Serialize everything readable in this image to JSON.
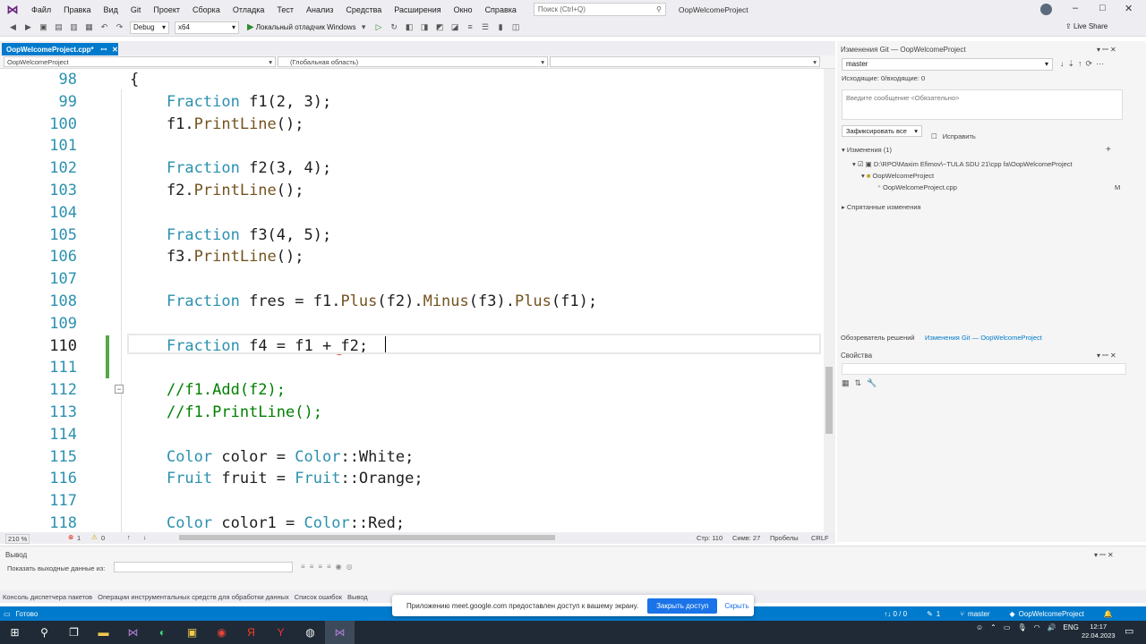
{
  "menu": {
    "items": [
      "Файл",
      "Правка",
      "Вид",
      "Git",
      "Проект",
      "Сборка",
      "Отладка",
      "Тест",
      "Анализ",
      "Средства",
      "Расширения",
      "Окно",
      "Справка"
    ],
    "search_placeholder": "Поиск (Ctrl+Q)",
    "window_title": "OopWelcomeProject",
    "live_share": "Live Share"
  },
  "toolbar": {
    "config": "Debug",
    "platform": "x64",
    "run_label": "Локальный отладчик Windows"
  },
  "document": {
    "tab_label": "OopWelcomeProject.cpp*",
    "nav_project": "OopWelcomeProject",
    "nav_scope": "(Глобальная область)"
  },
  "code_lines": [
    {
      "n": "98",
      "code": [
        {
          "t": "{",
          "k": "p"
        }
      ]
    },
    {
      "n": "99",
      "code": [
        {
          "t": "    ",
          "k": "p"
        },
        {
          "t": "Fraction",
          "k": "t"
        },
        {
          "t": " f1(2, 3);",
          "k": "p"
        }
      ]
    },
    {
      "n": "100",
      "code": [
        {
          "t": "    f1.",
          "k": "p"
        },
        {
          "t": "PrintLine",
          "k": "f"
        },
        {
          "t": "();",
          "k": "p"
        }
      ]
    },
    {
      "n": "101",
      "code": []
    },
    {
      "n": "102",
      "code": [
        {
          "t": "    ",
          "k": "p"
        },
        {
          "t": "Fraction",
          "k": "t"
        },
        {
          "t": " f2(3, 4);",
          "k": "p"
        }
      ]
    },
    {
      "n": "103",
      "code": [
        {
          "t": "    f2.",
          "k": "p"
        },
        {
          "t": "PrintLine",
          "k": "f"
        },
        {
          "t": "();",
          "k": "p"
        }
      ]
    },
    {
      "n": "104",
      "code": []
    },
    {
      "n": "105",
      "code": [
        {
          "t": "    ",
          "k": "p"
        },
        {
          "t": "Fraction",
          "k": "t"
        },
        {
          "t": " f3(4, 5);",
          "k": "p"
        }
      ]
    },
    {
      "n": "106",
      "code": [
        {
          "t": "    f3.",
          "k": "p"
        },
        {
          "t": "PrintLine",
          "k": "f"
        },
        {
          "t": "();",
          "k": "p"
        }
      ]
    },
    {
      "n": "107",
      "code": []
    },
    {
      "n": "108",
      "code": [
        {
          "t": "    ",
          "k": "p"
        },
        {
          "t": "Fraction",
          "k": "t"
        },
        {
          "t": " fres = f1.",
          "k": "p"
        },
        {
          "t": "Plus",
          "k": "f"
        },
        {
          "t": "(f2).",
          "k": "p"
        },
        {
          "t": "Minus",
          "k": "f"
        },
        {
          "t": "(f3).",
          "k": "p"
        },
        {
          "t": "Plus",
          "k": "f"
        },
        {
          "t": "(f1);",
          "k": "p"
        }
      ]
    },
    {
      "n": "109",
      "code": []
    },
    {
      "n": "110",
      "code": [
        {
          "t": "    ",
          "k": "p"
        },
        {
          "t": "Fraction",
          "k": "t"
        },
        {
          "t": " f4 = f1 + f2;",
          "k": "p"
        }
      ]
    },
    {
      "n": "111",
      "code": []
    },
    {
      "n": "112",
      "code": [
        {
          "t": "    //f1.Add(f2);",
          "k": "c"
        }
      ]
    },
    {
      "n": "113",
      "code": [
        {
          "t": "    //f1.PrintLine();",
          "k": "c"
        }
      ]
    },
    {
      "n": "114",
      "code": []
    },
    {
      "n": "115",
      "code": [
        {
          "t": "    ",
          "k": "p"
        },
        {
          "t": "Color",
          "k": "t"
        },
        {
          "t": " color = ",
          "k": "p"
        },
        {
          "t": "Color",
          "k": "t"
        },
        {
          "t": "::White;",
          "k": "p"
        }
      ]
    },
    {
      "n": "116",
      "code": [
        {
          "t": "    ",
          "k": "p"
        },
        {
          "t": "Fruit",
          "k": "t"
        },
        {
          "t": " fruit = ",
          "k": "p"
        },
        {
          "t": "Fruit",
          "k": "t"
        },
        {
          "t": "::Orange;",
          "k": "p"
        }
      ]
    },
    {
      "n": "117",
      "code": []
    },
    {
      "n": "118",
      "code": [
        {
          "t": "    ",
          "k": "p"
        },
        {
          "t": "Color",
          "k": "t"
        },
        {
          "t": " color1 = ",
          "k": "p"
        },
        {
          "t": "Color",
          "k": "t"
        },
        {
          "t": "::Red;",
          "k": "p"
        }
      ]
    }
  ],
  "current_line": "110",
  "editor_status": {
    "zoom": "210 %",
    "errors": "1",
    "warnings": "0",
    "line": "Стр: 110",
    "col": "Симв: 27",
    "ws": "Пробелы",
    "eol": "CRLF"
  },
  "git_panel": {
    "title": "Изменения Git — OopWelcomeProject",
    "branch": "master",
    "outgoing": "Исходящие: 0/входящие: 0",
    "message_placeholder": "Введите сообщение <Обязательно>",
    "commit_all": "Зафиксировать все",
    "amend": "Исправить",
    "changes_header": "Изменения (1)",
    "repo_path": "D:\\RPO\\Maxim Efimov\\~TULA SDU 21\\cpp fa\\OopWelcomeProject",
    "folder": "OopWelcomeProject",
    "file": "OopWelcomeProject.cpp",
    "file_status": "M",
    "stashed": "Спрятанные изменения"
  },
  "right_tabs": [
    "Обозреватель решений",
    "Изменения Git — OopWelcomeProject"
  ],
  "properties": {
    "title": "Свойства"
  },
  "output": {
    "title": "Вывод",
    "show_from": "Показать выходные данные из:"
  },
  "bottom_tabs": [
    "Консоль диспетчера пакетов",
    "Операции инструментальных средств для обработки данных",
    "Список ошибок",
    "Вывод"
  ],
  "statusbar": {
    "ready": "Готово",
    "updown": "↑↓ 0 / 0",
    "pencil": "1",
    "branch": "master",
    "project": "OopWelcomeProject"
  },
  "share_bar": {
    "text": "Приложению meet.google.com предоставлен доступ к вашему экрану.",
    "stop": "Закрыть доступ",
    "hide": "Скрыть"
  },
  "taskbar": {
    "lang": "ENG",
    "time": "12:17",
    "date": "22.04.2023"
  }
}
